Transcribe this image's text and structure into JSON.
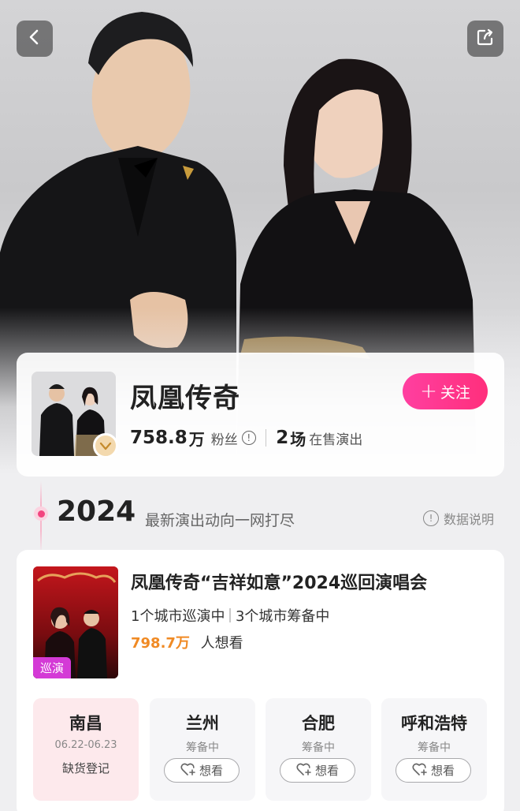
{
  "nav": {
    "back_icon": "chevron-left-icon",
    "share_icon": "share-icon"
  },
  "artist": {
    "name": "凤凰传奇",
    "fans_count": "758.8",
    "fans_unit": "万",
    "fans_label": "粉丝",
    "shows_count": "2",
    "shows_unit": "场",
    "shows_label": "在售演出",
    "follow_label": "关注"
  },
  "timeline": {
    "year": "2024",
    "subtitle": "最新演出动向一网打尽",
    "data_note": "数据说明"
  },
  "tour": {
    "title": "凤凰传奇“吉祥如意”2024巡回演唱会",
    "cities_touring": "1个城市巡演中",
    "cities_preparing": "3个城市筹备中",
    "want_count": "798.7万",
    "want_label": "人想看",
    "poster_tag": "巡演",
    "cities": [
      {
        "name": "南昌",
        "date": "06.22-06.23",
        "status": "缺货登记"
      },
      {
        "name": "兰州",
        "status": "筹备中",
        "button": "想看"
      },
      {
        "name": "合肥",
        "status": "筹备中",
        "button": "想看"
      },
      {
        "name": "呼和浩特",
        "status": "筹备中",
        "button": "想看"
      }
    ]
  },
  "colors": {
    "accent_pink": "#ff2f7c",
    "want_orange": "#f08a24",
    "tag_purple": "#d43ad6"
  }
}
